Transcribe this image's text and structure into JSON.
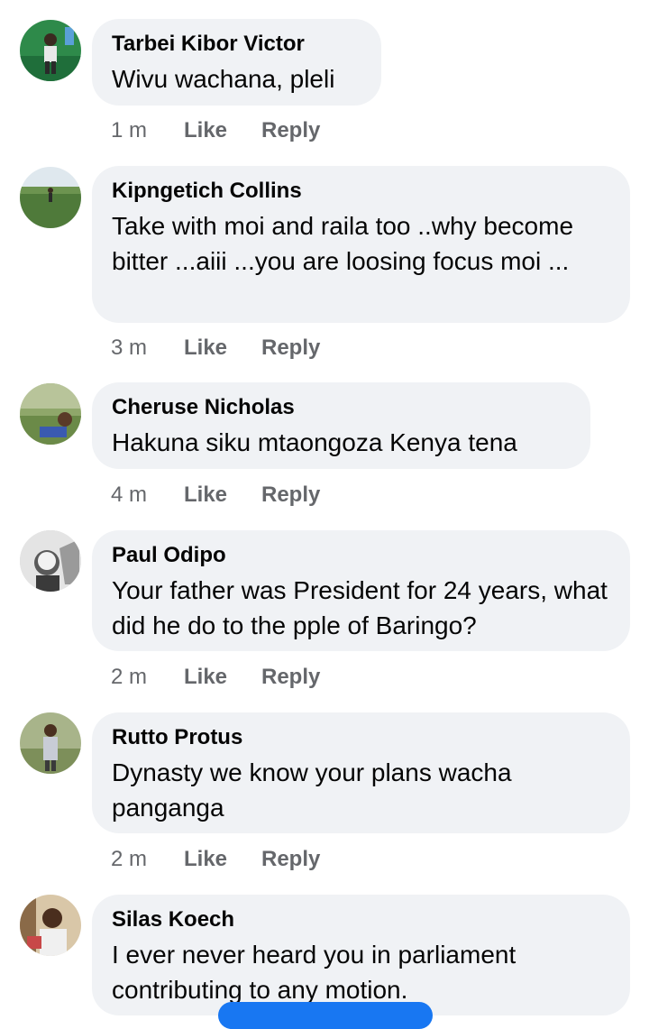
{
  "comments": [
    {
      "author": "Tarbei Kibor Victor",
      "text": "Wivu wachana, pleli",
      "time": "1 m"
    },
    {
      "author": "Kipngetich Collins",
      "text": "Take with moi and raila too ..why become bitter ...aiii ...you are loosing focus moi ...",
      "time": "3 m"
    },
    {
      "author": "Cheruse Nicholas",
      "text": "Hakuna siku mtaongoza Kenya tena",
      "time": "4 m"
    },
    {
      "author": "Paul Odipo",
      "text": "Your father was President for 24 years, what did he do to the pple of Baringo?",
      "time": "2 m"
    },
    {
      "author": "Rutto Protus",
      "text": "Dynasty we know your plans wacha panganga",
      "time": "2 m"
    },
    {
      "author": "Silas Koech",
      "text": "I ever never heard you  in parliament contributing to any motion.",
      "time": ""
    }
  ],
  "actions": {
    "like": "Like",
    "reply": "Reply"
  },
  "colors": {
    "bubble": "#f0f2f5",
    "meta": "#65676b",
    "accent": "#1877f2"
  }
}
